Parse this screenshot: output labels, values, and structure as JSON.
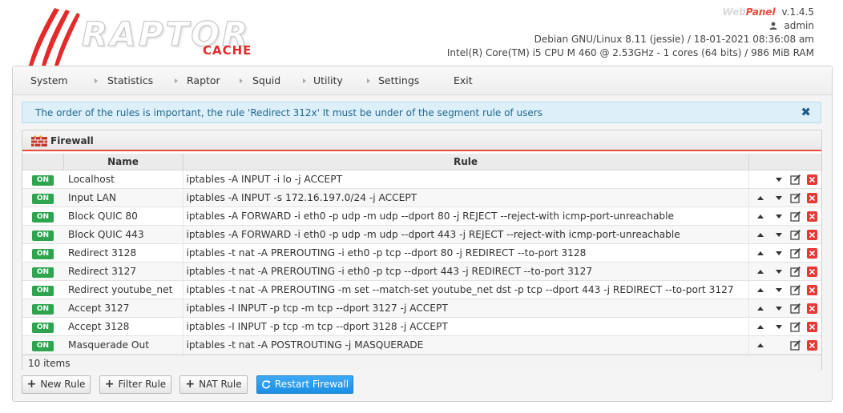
{
  "header": {
    "logo_text": "RAPTOR",
    "logo_sub": "CACHE",
    "brand_web": "Web",
    "brand_panel": "Panel",
    "version": "v.1.4.5",
    "user": "admin",
    "os_line": "Debian GNU/Linux 8.11 (jessie) / 18-01-2021 08:36:08 am",
    "cpu_line": "Intel(R) Core(TM) i5 CPU M 460 @ 2.53GHz -  1 cores  (64 bits)  /  986 MiB RAM"
  },
  "nav": {
    "items": [
      {
        "label": "System"
      },
      {
        "label": "Statistics"
      },
      {
        "label": "Raptor"
      },
      {
        "label": "Squid"
      },
      {
        "label": "Utility"
      },
      {
        "label": "Settings"
      },
      {
        "label": "Exit"
      }
    ]
  },
  "alert": {
    "text": "The order of the rules is important, the rule 'Redirect 312x' It must be under of the segment rule of users",
    "close": "✖"
  },
  "firewall": {
    "title": "Firewall",
    "columns": {
      "name": "Name",
      "rule": "Rule"
    },
    "rows": [
      {
        "status": "ON",
        "name": "Localhost",
        "rule": "iptables -A INPUT -i lo -j ACCEPT",
        "up": false,
        "down": true
      },
      {
        "status": "ON",
        "name": "Input LAN",
        "rule": "iptables -A INPUT -s 172.16.197.0/24 -j ACCEPT",
        "up": true,
        "down": true
      },
      {
        "status": "ON",
        "name": "Block QUIC 80",
        "rule": "iptables -A FORWARD -i eth0 -p udp -m udp --dport 80 -j REJECT --reject-with icmp-port-unreachable",
        "up": true,
        "down": true
      },
      {
        "status": "ON",
        "name": "Block QUIC 443",
        "rule": "iptables -A FORWARD -i eth0 -p udp -m udp --dport 443 -j REJECT --reject-with icmp-port-unreachable",
        "up": true,
        "down": true
      },
      {
        "status": "ON",
        "name": "Redirect 3128",
        "rule": "iptables -t nat -A PREROUTING -i eth0 -p tcp --dport 80 -j REDIRECT --to-port 3128",
        "up": true,
        "down": true
      },
      {
        "status": "ON",
        "name": "Redirect 3127",
        "rule": "iptables -t nat -A PREROUTING -i eth0 -p tcp --dport 443 -j REDIRECT --to-port 3127",
        "up": true,
        "down": true
      },
      {
        "status": "ON",
        "name": "Redirect youtube_net",
        "rule": "iptables -t nat -A PREROUTING -m set --match-set youtube_net dst -p tcp --dport 443 -j REDIRECT --to-port 3127",
        "up": true,
        "down": true
      },
      {
        "status": "ON",
        "name": "Accept 3127",
        "rule": "iptables -I INPUT -p tcp -m tcp --dport 3127 -j ACCEPT",
        "up": true,
        "down": true
      },
      {
        "status": "ON",
        "name": "Accept 3128",
        "rule": "iptables -I INPUT -p tcp -m tcp --dport 3128 -j ACCEPT",
        "up": true,
        "down": true
      },
      {
        "status": "ON",
        "name": "Masquerade Out",
        "rule": "iptables -t nat -A POSTROUTING -j MASQUERADE",
        "up": true,
        "down": false
      }
    ],
    "count": "10 items"
  },
  "buttons": {
    "new_rule": "New Rule",
    "filter_rule": "Filter Rule",
    "nat_rule": "NAT Rule",
    "restart": "Restart Firewall"
  },
  "colors": {
    "accent_red": "#e74c3c",
    "on_green": "#2ea44f",
    "primary_blue": "#1b8fe3",
    "alert_text": "#21688f"
  }
}
